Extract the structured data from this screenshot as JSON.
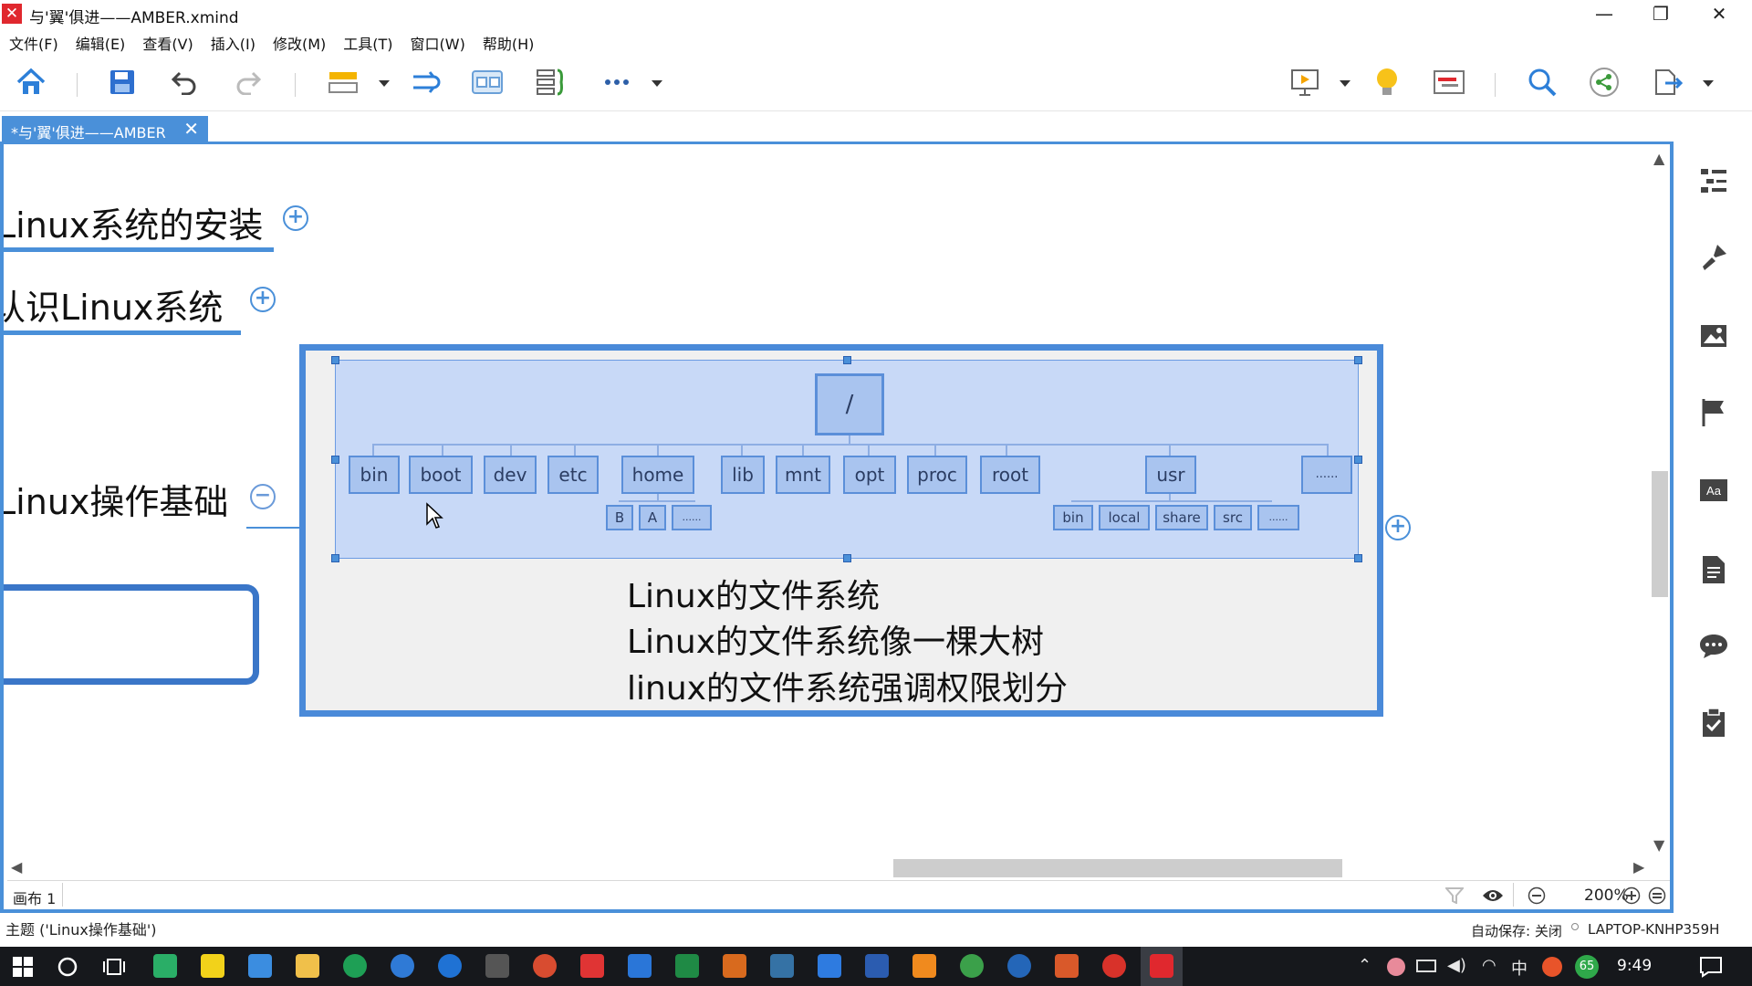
{
  "window": {
    "title": "与'翼'俱进——AMBER.xmind",
    "minimize": "—",
    "restore": "❐",
    "close": "✕"
  },
  "menu": [
    "文件(F)",
    "编辑(E)",
    "查看(V)",
    "插入(I)",
    "修改(M)",
    "工具(T)",
    "窗口(W)",
    "帮助(H)"
  ],
  "tab": {
    "label": "*与'翼'俱进——AMBER",
    "close": "✕"
  },
  "topics": {
    "install": "Linux系统的安装",
    "know": "认识Linux系统",
    "basics": "Linux操作基础",
    "plus": "+",
    "minus": "−"
  },
  "diagram": {
    "root": "/",
    "dirs": [
      "bin",
      "boot",
      "dev",
      "etc",
      "home",
      "lib",
      "mnt",
      "opt",
      "proc",
      "root",
      "usr",
      "......"
    ],
    "home_children": [
      "B",
      "A",
      "......"
    ],
    "usr_children": [
      "bin",
      "local",
      "share",
      "src",
      "......"
    ]
  },
  "note_lines": [
    "Linux的文件系统",
    "Linux的文件系统像一棵大树",
    "linux的文件系统强调权限划分"
  ],
  "canvas_status": {
    "sheet": "画布 1",
    "zoom": "200%"
  },
  "status_bar": {
    "left": "主题 ('Linux操作基础')",
    "autosave": "自动保存: 关闭",
    "machine": "LAPTOP-KNHP359H"
  },
  "taskbar": {
    "time": "9:49",
    "ime": "中",
    "badge": "65"
  },
  "colors": {
    "accent": "#4a90d9",
    "diagram_fill": "#c8d9f7",
    "node_fill": "#a9c4ef",
    "brand": "#e0282e"
  }
}
